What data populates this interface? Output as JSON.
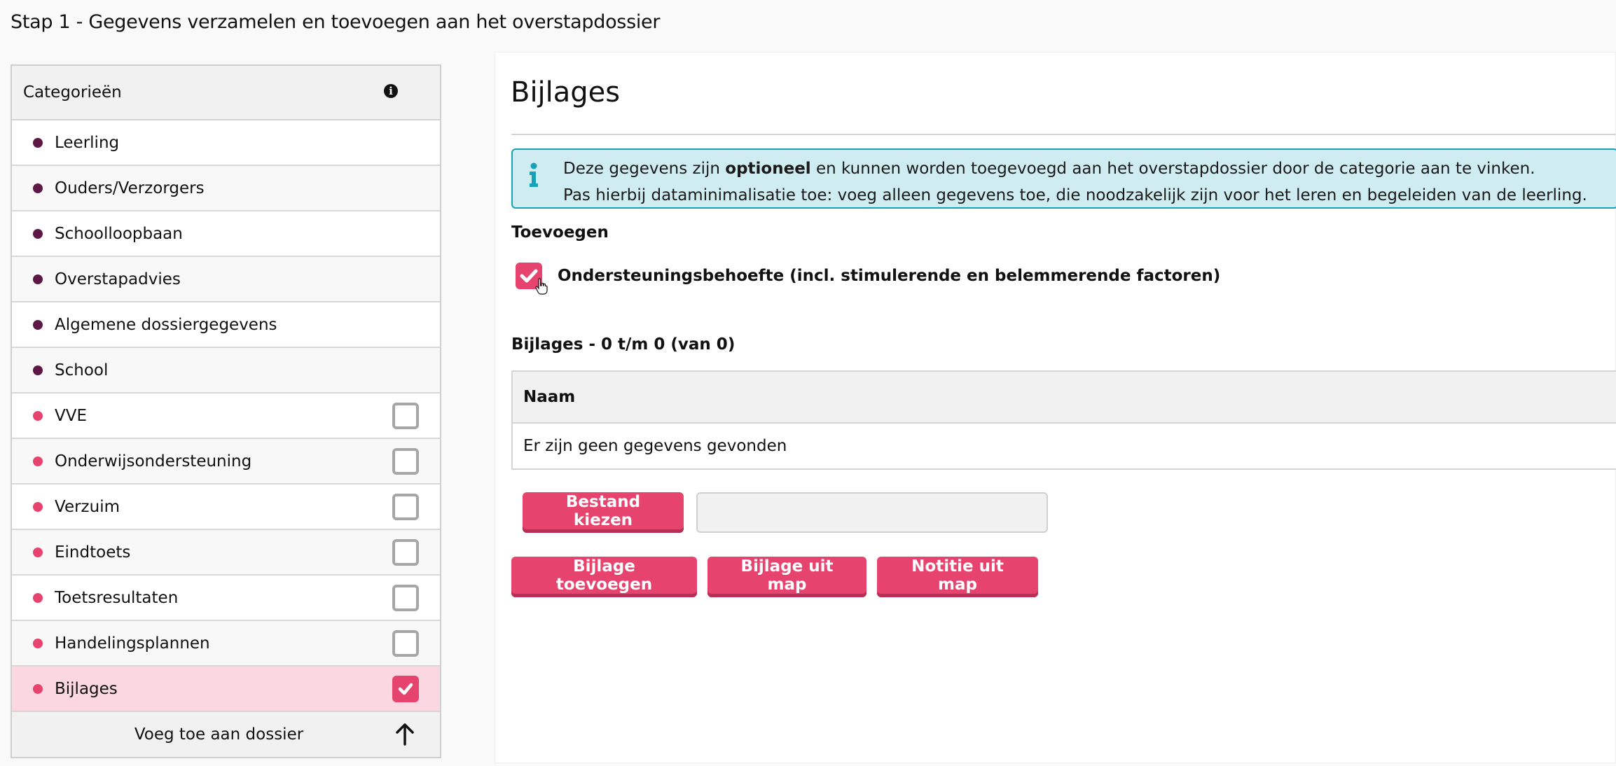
{
  "page": {
    "title": "Stap 1 - Gegevens verzamelen en toevoegen aan het overstapdossier"
  },
  "sidebar": {
    "header": "Categorieën",
    "info_icon": "info-circle-icon",
    "items": [
      {
        "label": "Leerling",
        "dot_color": "#5e1845",
        "checkbox": null
      },
      {
        "label": "Ouders/Verzorgers",
        "dot_color": "#5e1845",
        "checkbox": null
      },
      {
        "label": "Schoolloopbaan",
        "dot_color": "#5e1845",
        "checkbox": null
      },
      {
        "label": "Overstapadvies",
        "dot_color": "#5e1845",
        "checkbox": null
      },
      {
        "label": "Algemene dossiergegevens",
        "dot_color": "#5e1845",
        "checkbox": null
      },
      {
        "label": "School",
        "dot_color": "#5e1845",
        "checkbox": null
      },
      {
        "label": "VVE",
        "dot_color": "#e6446f",
        "checkbox": false
      },
      {
        "label": "Onderwijsondersteuning",
        "dot_color": "#e6446f",
        "checkbox": false
      },
      {
        "label": "Verzuim",
        "dot_color": "#e6446f",
        "checkbox": false
      },
      {
        "label": "Eindtoets",
        "dot_color": "#e6446f",
        "checkbox": false
      },
      {
        "label": "Toetsresultaten",
        "dot_color": "#e6446f",
        "checkbox": false
      },
      {
        "label": "Handelingsplannen",
        "dot_color": "#e6446f",
        "checkbox": false
      },
      {
        "label": "Bijlages",
        "dot_color": "#e6446f",
        "checkbox": true,
        "selected": true
      }
    ],
    "footer": "Voeg toe aan dossier"
  },
  "main": {
    "title": "Bijlages",
    "alert": {
      "line1_pre": "Deze gegevens zijn ",
      "line1_bold": "optioneel",
      "line1_post": " en kunnen worden toegevoegd aan het overstapdossier door de categorie aan te vinken.",
      "line2": "Pas hierbij dataminimalisatie toe: voeg alleen gegevens toe, die noodzakelijk zijn voor het leren en begeleiden van de leerling."
    },
    "add_label": "Toevoegen",
    "add_checkbox": {
      "label": "Ondersteuningsbehoefte (incl. stimulerende en belemmerende factoren)",
      "checked": true
    },
    "list_title": "Bijlages - 0 t/m 0 (van 0)",
    "table": {
      "columns": [
        "Naam"
      ],
      "empty_text": "Er zijn geen gegevens gevonden"
    },
    "file_button": "Bestand kiezen",
    "file_value": "",
    "buttons": [
      "Bijlage toevoegen",
      "Bijlage uit map",
      "Notitie uit map"
    ]
  },
  "colors": {
    "accent": "#e6446f",
    "accent_dark": "#b72f55",
    "selected_row": "#fad7e1",
    "info_bg": "#cfedf1",
    "info_border": "#17a2b8",
    "dot_mandatory": "#5e1845"
  }
}
